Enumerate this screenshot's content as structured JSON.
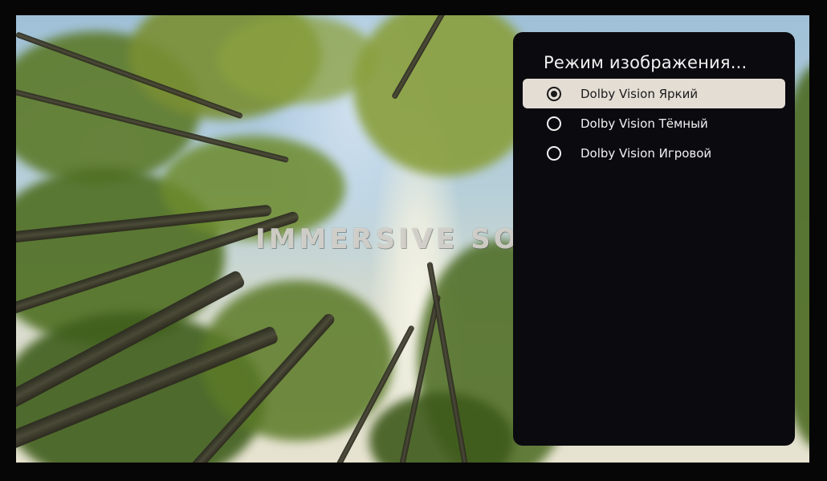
{
  "background": {
    "watermark_text": "IMMERSIVE SOU",
    "colors": {
      "frame": "#060606",
      "canopy": "#2f4a1c",
      "sky": "#b7cfd8"
    }
  },
  "menu": {
    "title": "Режим изображения...",
    "options": [
      {
        "label": "Dolby Vision Яркий",
        "selected": true,
        "icon": "radio-selected-icon"
      },
      {
        "label": "Dolby Vision Тёмный",
        "selected": false,
        "icon": "radio-unselected-icon"
      },
      {
        "label": "Dolby Vision Игровой",
        "selected": false,
        "icon": "radio-unselected-icon"
      }
    ],
    "colors": {
      "panel_bg": "#0b0a0f",
      "highlight_bg": "#e3ddd4",
      "text": "#f2f2f2",
      "highlight_text": "#1c1c1c"
    }
  }
}
